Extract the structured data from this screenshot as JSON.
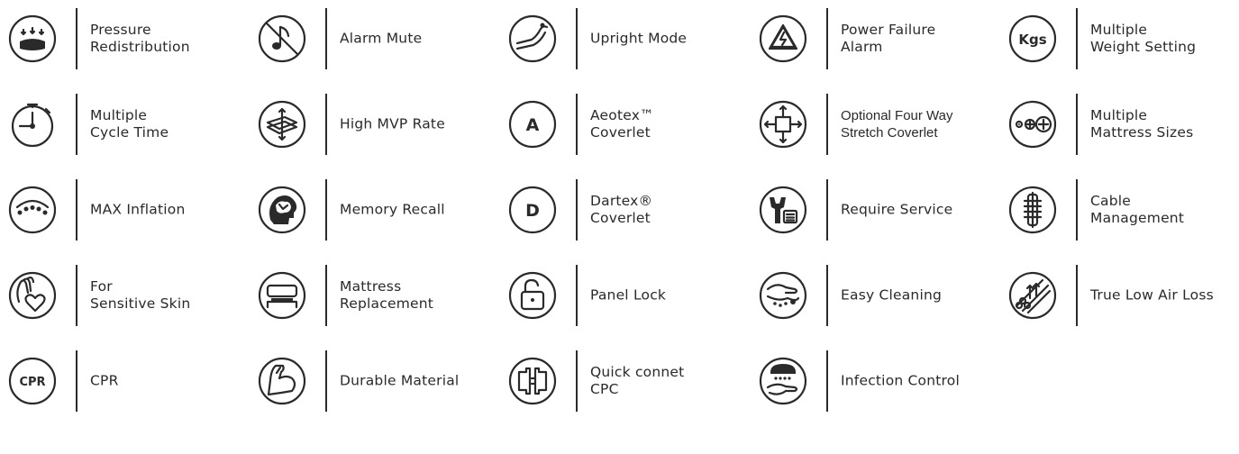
{
  "features": [
    {
      "id": "pressure-redistribution",
      "lines": [
        "Pressure",
        "Redistribution"
      ],
      "icon": "pressure-redistribution-icon"
    },
    {
      "id": "alarm-mute",
      "lines": [
        "Alarm Mute"
      ],
      "icon": "alarm-mute-icon"
    },
    {
      "id": "upright-mode",
      "lines": [
        "Upright Mode"
      ],
      "icon": "upright-mode-icon"
    },
    {
      "id": "power-failure-alarm",
      "lines": [
        "Power Failure",
        "Alarm"
      ],
      "icon": "power-failure-alarm-icon"
    },
    {
      "id": "multiple-weight-setting",
      "lines": [
        "Multiple",
        "Weight Setting"
      ],
      "icon": "kgs-icon",
      "icon_text": "Kgs"
    },
    {
      "id": "multiple-cycle-time",
      "lines": [
        "Multiple",
        "Cycle Time"
      ],
      "icon": "stopwatch-icon"
    },
    {
      "id": "high-mvp-rate",
      "lines": [
        "High MVP Rate"
      ],
      "icon": "high-mvp-rate-icon"
    },
    {
      "id": "aeotex-coverlet",
      "lines": [
        "Aeotex™",
        "Coverlet"
      ],
      "icon": "letter-a-icon",
      "icon_text": "A"
    },
    {
      "id": "four-way-stretch-coverlet",
      "lines": [
        "Optional Four Way",
        "Stretch Coverlet"
      ],
      "icon": "four-way-stretch-icon",
      "narrow": true
    },
    {
      "id": "multiple-mattress-sizes",
      "lines": [
        "Multiple",
        "Mattress Sizes"
      ],
      "icon": "mattress-sizes-icon"
    },
    {
      "id": "max-inflation",
      "lines": [
        "MAX Inflation"
      ],
      "icon": "max-inflation-icon"
    },
    {
      "id": "memory-recall",
      "lines": [
        "Memory Recall"
      ],
      "icon": "memory-recall-icon"
    },
    {
      "id": "dartex-coverlet",
      "lines": [
        "Dartex®",
        "Coverlet"
      ],
      "icon": "letter-d-icon",
      "icon_text": "D"
    },
    {
      "id": "require-service",
      "lines": [
        "Require Service"
      ],
      "icon": "require-service-icon"
    },
    {
      "id": "cable-management",
      "lines": [
        "Cable",
        "Management"
      ],
      "icon": "cable-management-icon"
    },
    {
      "id": "sensitive-skin",
      "lines": [
        "For",
        "Sensitive Skin"
      ],
      "icon": "sensitive-skin-icon"
    },
    {
      "id": "mattress-replacement",
      "lines": [
        "Mattress",
        "Replacement"
      ],
      "icon": "mattress-replacement-icon"
    },
    {
      "id": "panel-lock",
      "lines": [
        "Panel Lock"
      ],
      "icon": "panel-lock-icon"
    },
    {
      "id": "easy-cleaning",
      "lines": [
        "Easy Cleaning"
      ],
      "icon": "easy-cleaning-icon"
    },
    {
      "id": "true-low-air-loss",
      "lines": [
        "True Low Air Loss"
      ],
      "icon": "low-air-loss-icon"
    },
    {
      "id": "cpr",
      "lines": [
        "CPR"
      ],
      "icon": "cpr-icon",
      "icon_text": "CPR"
    },
    {
      "id": "durable-material",
      "lines": [
        "Durable Material"
      ],
      "icon": "durable-material-icon"
    },
    {
      "id": "quick-connect-cpc",
      "lines": [
        "Quick connet",
        "CPC"
      ],
      "icon": "quick-connect-icon"
    },
    {
      "id": "infection-control",
      "lines": [
        "Infection Control"
      ],
      "icon": "infection-control-icon"
    }
  ]
}
